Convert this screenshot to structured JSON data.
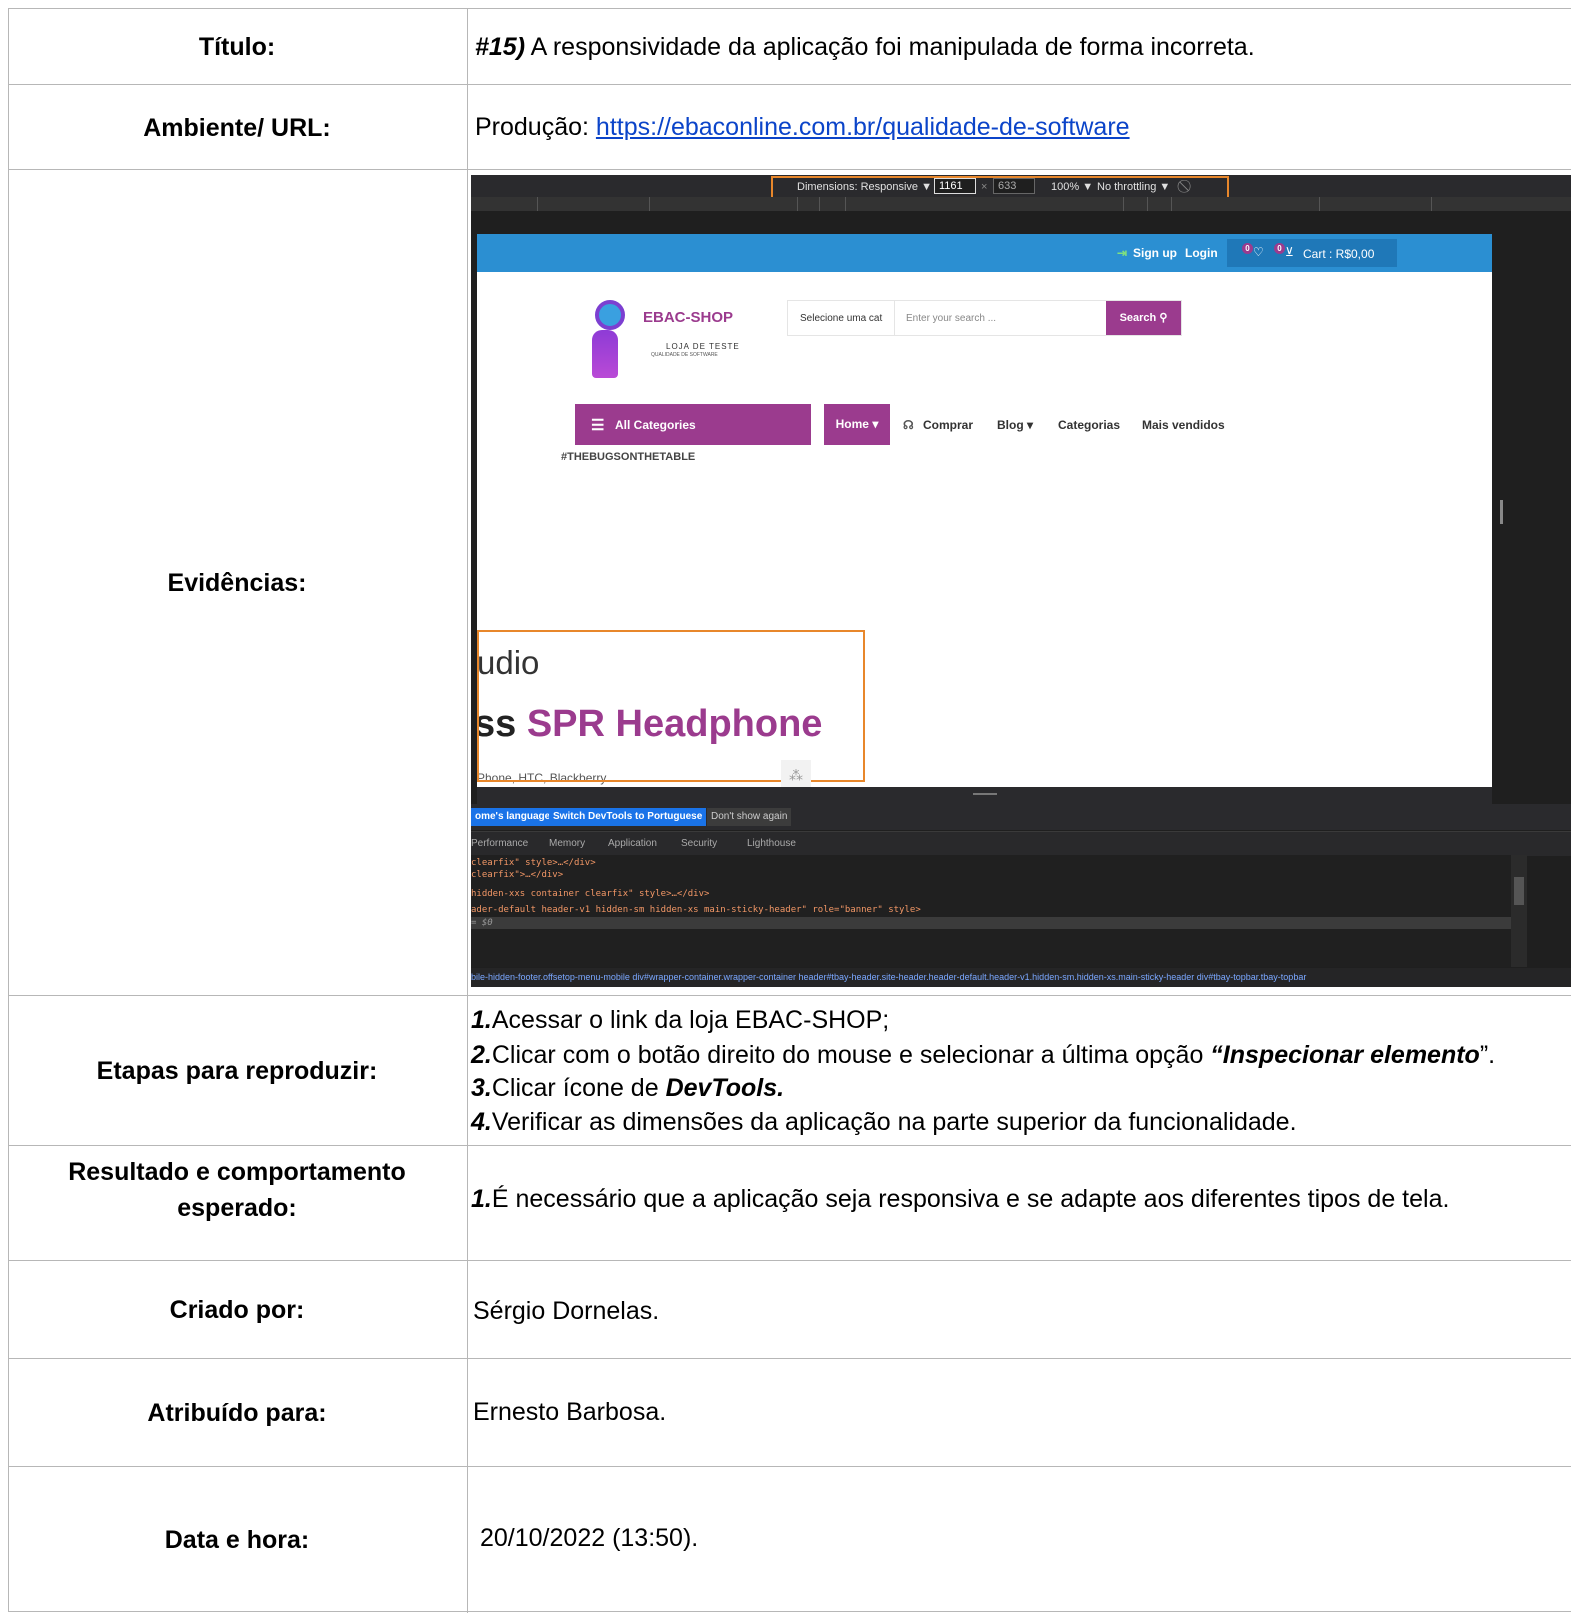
{
  "rows": [
    {
      "label": "Título:"
    },
    {
      "label": "Ambiente/ URL:"
    },
    {
      "label": "Evidências:"
    },
    {
      "label": "Etapas para reproduzir:"
    },
    {
      "label": "Resultado e comportamento esperado:"
    },
    {
      "label": "Criado por:"
    },
    {
      "label": "Atribuído para:"
    },
    {
      "label": "Data e hora:"
    }
  ],
  "titulo": {
    "id": "#15)",
    "text": " A responsividade da aplicação foi manipulada de forma incorreta."
  },
  "ambiente": {
    "prefix": "Produção: ",
    "url": "https://ebaconline.com.br/qualidade-de-software"
  },
  "etapas": [
    {
      "num": "1.",
      "text": "Acessar o link da loja EBAC-SHOP;"
    },
    {
      "num": "2.",
      "text": "Clicar com o botão direito do mouse e selecionar a última opção ",
      "strong": "“Inspecionar elemento",
      "after": "”."
    },
    {
      "num": "3.",
      "text": "Clicar ícone de ",
      "strong": "DevTools."
    },
    {
      "num": "4.",
      "text": "Verificar as dimensões da aplicação na parte superior da funcionalidade."
    }
  ],
  "resultado": {
    "num": "1.",
    "text": "É necessário que a aplicação seja responsiva e se adapte aos diferentes tipos de tela."
  },
  "criado_por": "Sérgio Dornelas.",
  "atribuido_para": "Ernesto Barbosa.",
  "data_hora": "20/10/2022 (13:50).",
  "evidencia": {
    "devtools": {
      "dimensions": "Dimensions: Responsive ▼",
      "width": "1161",
      "x": "×",
      "height": "633",
      "zoom": "100% ▼",
      "throttling": "No throttling ▼",
      "rotate_icon": "rotate-icon"
    },
    "site": {
      "signup": "Sign up",
      "login": "Login",
      "wishlist_count": "0",
      "cart_count": "0",
      "cart": "Cart : R$0,00",
      "logo_title": "EBAC-SHOP",
      "logo_sub": "LOJA DE TESTE",
      "logo_sub2": "QUALIDADE DE SOFTWARE",
      "search_cat": "Selecione uma cat",
      "search_placeholder": "Enter your search ...",
      "search_button": "Search",
      "all_categories": "All Categories",
      "home": "Home ▾",
      "nav": [
        "Comprar",
        "Blog ▾",
        "Categorias",
        "Mais vendidos"
      ],
      "tag": "#THEBUGSONTHETABLE",
      "hero1": "udio",
      "hero2_a": "ss ",
      "hero2_b": "SPR Headphone",
      "hero3": "Phone, HTC, Blackberry"
    },
    "infobar": [
      "ome's language",
      "Switch DevTools to Portuguese",
      "Don't show again"
    ],
    "tabs": [
      "Performance",
      "Memory",
      "Application",
      "Security",
      "Lighthouse"
    ],
    "code": [
      "clearfix\" style>…</div>",
      "clearfix\">…</div>",
      "hidden-xxs container clearfix\" style>…</div>",
      "ader-default header-v1 hidden-sm hidden-xs main-sticky-header\" role=\"banner\" style>",
      "= $0"
    ],
    "breadcrumbs": "bile-hidden-footer.offsetop-menu-mobile   div#wrapper-container.wrapper-container   header#tbay-header.site-header.header-default.header-v1.hidden-sm.hidden-xs.main-sticky-header   div#tbay-topbar.tbay-topbar"
  }
}
